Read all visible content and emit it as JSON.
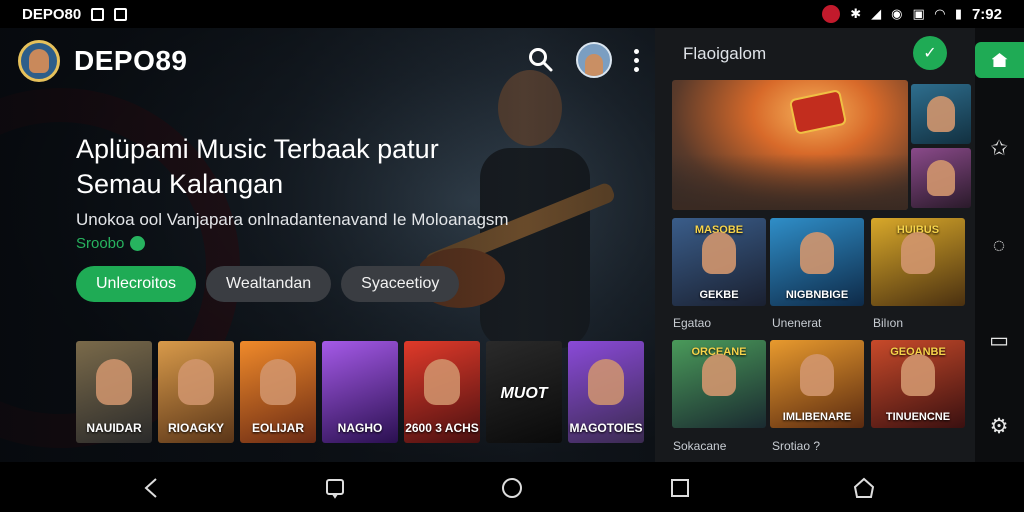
{
  "status_bar": {
    "left_text": "DEPO80",
    "time": "7:92"
  },
  "app": {
    "name": "DEPO89"
  },
  "hero": {
    "headline": "Aplüpami Music Terbaak patur Semau Kalangan",
    "subline": "Unokoa ool Vanjapara onlnadantenavand Ie Moloanagsm",
    "link_text": "Sroobo"
  },
  "chips": [
    {
      "label": "Unlecroitos",
      "active": true
    },
    {
      "label": "Wealtandan",
      "active": false
    },
    {
      "label": "Syaceetioy",
      "active": false
    }
  ],
  "thumbnails": [
    {
      "caption": "NAUIDAR",
      "color": "#5a4a2a"
    },
    {
      "caption": "RIOAGKY",
      "color": "#b9752f"
    },
    {
      "caption": "EOLIJAR",
      "color": "#d46a28"
    },
    {
      "caption": "NAGHO",
      "color": "#5a2a9a"
    },
    {
      "caption": "2600 3 ACHS",
      "color": "#b52626"
    },
    {
      "caption": "MUOT",
      "color": "#1a1a1a"
    },
    {
      "caption": "MAGOTOIES",
      "color": "#6a3aa8"
    }
  ],
  "panel": {
    "title": "Flaoigalom",
    "fab_label": "✓",
    "grid": [
      {
        "top": "MASOBE",
        "caption": "GEKBE",
        "label": "Egatao",
        "color": "#3a5d8a"
      },
      {
        "top": "",
        "caption": "NIGBNBIGE",
        "label": "Unenerat",
        "color": "#2f6ea8"
      },
      {
        "top": "HUIBUS",
        "caption": "",
        "label": "Bilıon",
        "color": "#b38a22"
      },
      {
        "top": "ORCEANE",
        "caption": "",
        "label": "Sokacane",
        "color": "#3d7a4a"
      },
      {
        "top": "",
        "caption": "IMLIBENARE",
        "label": "Srotiao ?",
        "color": "#c97a1e"
      },
      {
        "top": "GEOANBE",
        "caption": "TINUENCNE",
        "label": "",
        "color": "#a3381e"
      }
    ]
  }
}
